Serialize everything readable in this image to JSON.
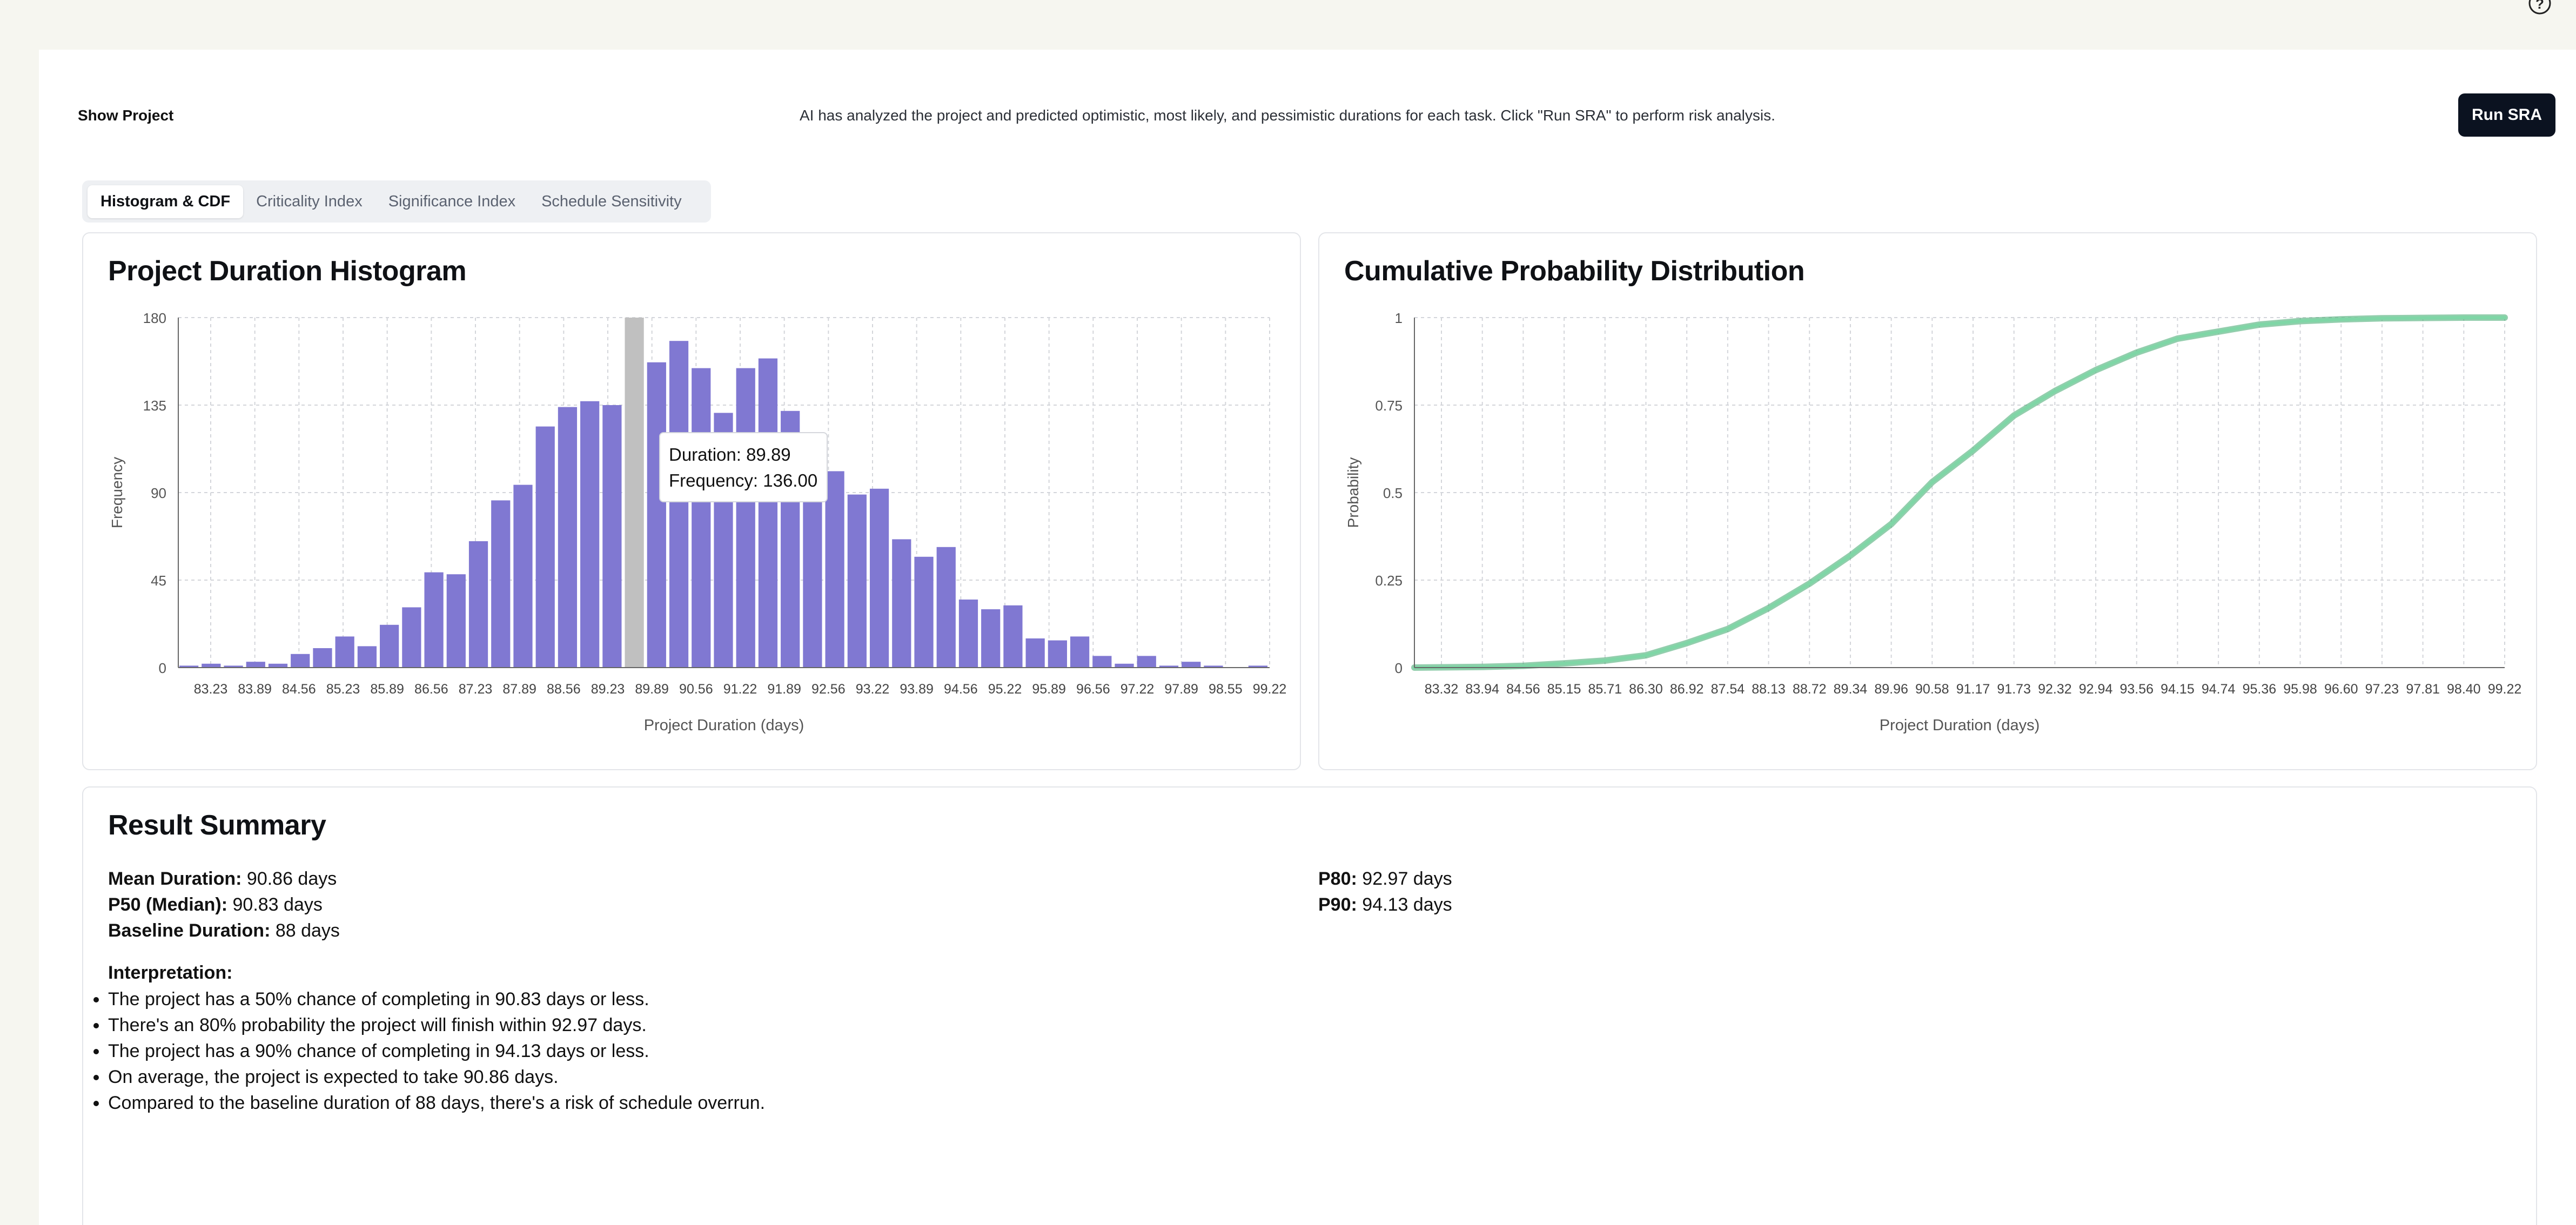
{
  "header": {
    "show_project_label": "Show Project",
    "info_text": "AI has analyzed the project and predicted optimistic, most likely, and pessimistic durations for each task. Click \"Run SRA\" to perform risk analysis.",
    "run_button_label": "Run SRA",
    "help_icon": "help-circle-icon"
  },
  "tabs": [
    {
      "label": "Histogram & CDF",
      "active": true
    },
    {
      "label": "Criticality Index",
      "active": false
    },
    {
      "label": "Significance Index",
      "active": false
    },
    {
      "label": "Schedule Sensitivity",
      "active": false
    }
  ],
  "colors": {
    "bar": "#8078d2",
    "bar_highlight": "#c0c0c0",
    "cdf_line": "#7fd6a6",
    "accent_dark": "#0b1220"
  },
  "histogram_card": {
    "title": "Project Duration Histogram"
  },
  "cdf_card": {
    "title": "Cumulative Probability Distribution"
  },
  "tooltip": {
    "duration_text": "Duration: 89.89",
    "frequency_text": "Frequency: 136.00"
  },
  "chart_data": [
    {
      "type": "bar",
      "title": "Project Duration Histogram",
      "xlabel": "Project Duration (days)",
      "ylabel": "Frequency",
      "ylim": [
        0,
        180
      ],
      "yticks": [
        "0",
        "45",
        "90",
        "135",
        "180"
      ],
      "xtick_labels": [
        "83.23",
        "83.89",
        "84.56",
        "85.23",
        "85.89",
        "86.56",
        "87.23",
        "87.89",
        "88.56",
        "89.23",
        "89.89",
        "90.56",
        "91.22",
        "91.89",
        "92.56",
        "93.22",
        "93.89",
        "94.56",
        "95.22",
        "95.89",
        "96.56",
        "97.22",
        "97.89",
        "98.55",
        "99.22"
      ],
      "grid": true,
      "values": [
        1,
        2,
        1,
        3,
        2,
        7,
        10,
        16,
        11,
        22,
        31,
        49,
        48,
        65,
        86,
        94,
        124,
        134,
        137,
        135,
        180,
        157,
        168,
        154,
        131,
        154,
        159,
        132,
        110,
        101,
        89,
        92,
        66,
        57,
        62,
        35,
        30,
        32,
        15,
        14,
        16,
        6,
        2,
        6,
        1,
        3,
        1,
        0,
        1
      ],
      "highlight_index": 20,
      "tooltip": {
        "duration": 89.89,
        "frequency": 136.0
      }
    },
    {
      "type": "line",
      "title": "Cumulative Probability Distribution",
      "xlabel": "Project Duration (days)",
      "ylabel": "Probability",
      "ylim": [
        0,
        1
      ],
      "yticks": [
        "0",
        "0.25",
        "0.5",
        "0.75",
        "1"
      ],
      "xtick_labels": [
        "83.32",
        "83.94",
        "84.56",
        "85.15",
        "85.71",
        "86.30",
        "86.92",
        "87.54",
        "88.13",
        "88.72",
        "89.34",
        "89.96",
        "90.58",
        "91.17",
        "91.73",
        "92.32",
        "92.94",
        "93.56",
        "94.15",
        "94.74",
        "95.36",
        "95.98",
        "96.60",
        "97.23",
        "97.81",
        "98.40",
        "99.22"
      ],
      "grid": true,
      "x": [
        83.32,
        83.94,
        84.56,
        85.15,
        85.71,
        86.3,
        86.92,
        87.54,
        88.13,
        88.72,
        89.34,
        89.96,
        90.58,
        91.17,
        91.73,
        92.32,
        92.94,
        93.56,
        94.15,
        94.74,
        95.36,
        95.98,
        96.6,
        97.23,
        97.81,
        98.4,
        99.22
      ],
      "y": [
        0.0,
        0.002,
        0.005,
        0.012,
        0.02,
        0.035,
        0.07,
        0.11,
        0.17,
        0.24,
        0.32,
        0.41,
        0.53,
        0.62,
        0.72,
        0.79,
        0.85,
        0.9,
        0.94,
        0.96,
        0.98,
        0.99,
        0.995,
        0.998,
        0.999,
        1.0,
        1.0
      ]
    }
  ],
  "summary": {
    "title": "Result Summary",
    "mean_label": "Mean Duration:",
    "mean_value": "90.86 days",
    "p50_label": "P50 (Median):",
    "p50_value": "90.83 days",
    "baseline_label": "Baseline Duration:",
    "baseline_value": "88 days",
    "p80_label": "P80:",
    "p80_value": "92.97 days",
    "p90_label": "P90:",
    "p90_value": "94.13 days",
    "interpretation_label": "Interpretation:",
    "interpretation": [
      "The project has a 50% chance of completing in 90.83 days or less.",
      "There's an 80% probability the project will finish within 92.97 days.",
      "The project has a 90% chance of completing in 94.13 days or less.",
      "On average, the project is expected to take 90.86 days.",
      "Compared to the baseline duration of 88 days, there's a risk of schedule overrun."
    ]
  }
}
